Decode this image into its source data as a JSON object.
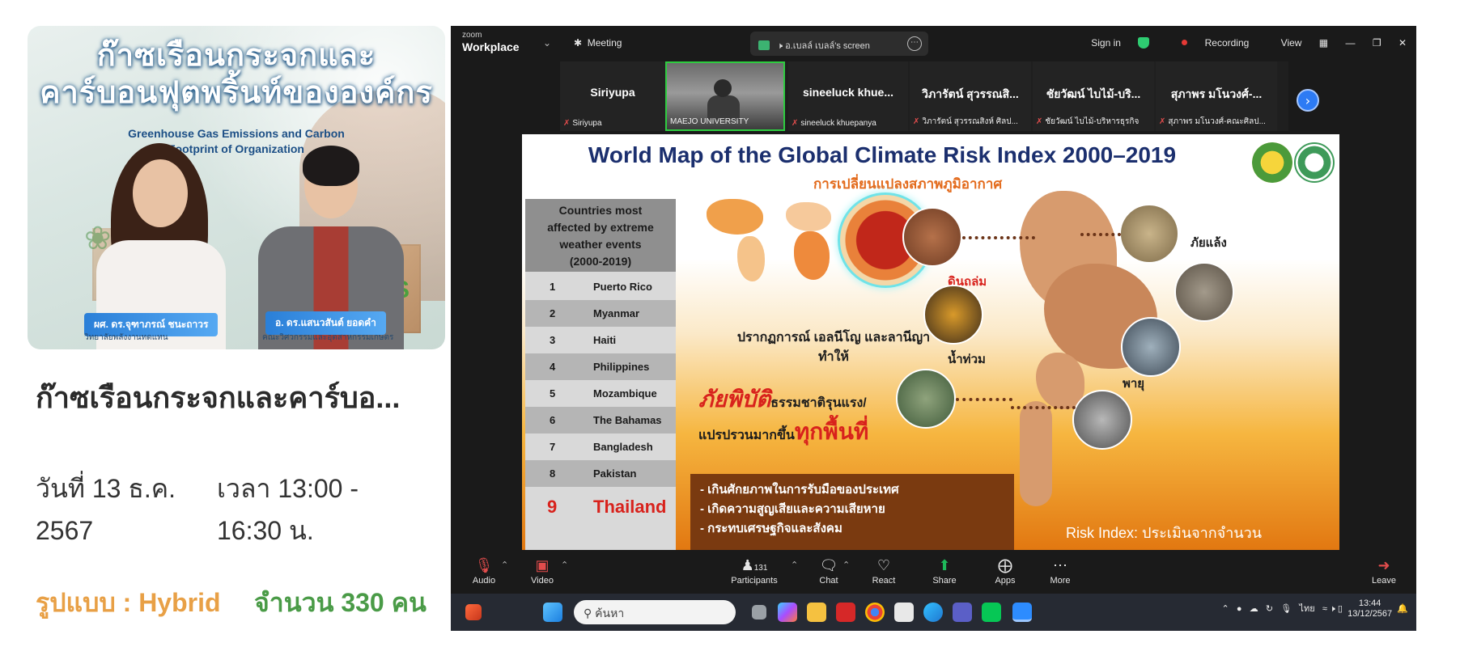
{
  "event": {
    "poster_title_line1": "ก๊าซเรือนกระจกและ",
    "poster_title_line2": "คาร์บอนฟุตพริ้นท์ขององค์กร",
    "poster_subtitle_line1": "Greenhouse Gas Emissions and Carbon",
    "poster_subtitle_line2": "Footprint of Organization",
    "speaker1_name": "ผศ. ดร.จุฑาภรณ์ ชนะถาวร",
    "speaker1_affiliation": "วิทยาลัยพลังงานทดแทน",
    "speaker2_name": "อ. ดร.แสนวสันต์ ยอดคำ",
    "speaker2_affiliation": "คณะวิศวกรรมและอุตสาหกรรมเกษตร",
    "poster_tag": "US",
    "title": "ก๊าซเรือนกระจกและคาร์บอ...",
    "date_line1": "วันที่ 13 ธ.ค.",
    "date_line2": "2567",
    "time_line1": "เวลา 13:00 -",
    "time_line2": "16:30 น.",
    "format": "รูปแบบ : Hybrid",
    "count": "จำนวน 330 คน"
  },
  "zoom": {
    "brand_top": "zoom",
    "brand_bottom": "Workplace",
    "meeting_label": "Meeting",
    "share_label": "อ.เบลล์ เบลล์'s screen",
    "sign_in": "Sign in",
    "recording": "Recording",
    "view": "View",
    "gallery": [
      {
        "name": "Siriyupa",
        "label": "Siriyupa"
      },
      {
        "name": "",
        "label": "MAEJO UNIVERSITY"
      },
      {
        "name": "sineeluck khue...",
        "label": "sineeluck khuepanya"
      },
      {
        "name": "วิภารัตน์ สุวรรณสิ...",
        "label": "วิภารัตน์ สุวรรณสิงห์ ศิลป..."
      },
      {
        "name": "ชัยวัฒน์ ไบไม้-บริ...",
        "label": "ชัยวัฒน์ ไบไม้-บริหารธุรกิจ"
      },
      {
        "name": "สุภาพร มโนวงศ์-...",
        "label": "สุภาพร มโนวงศ์-คณะศิลป..."
      }
    ],
    "controls": {
      "audio": "Audio",
      "video": "Video",
      "participants": "Participants",
      "participants_count": "131",
      "chat": "Chat",
      "react": "React",
      "share": "Share",
      "apps": "Apps",
      "more": "More",
      "leave": "Leave"
    }
  },
  "slide": {
    "title": "World Map of the Global Climate Risk Index 2000–2019",
    "subtitle": "การเปลี่ยนแปลงสภาพภูมิอากาศ",
    "rank_header_1": "Countries most",
    "rank_header_2": "affected by extreme",
    "rank_header_3": "weather events",
    "rank_header_4": "(2000-2019)",
    "ranks": [
      {
        "n": "1",
        "c": "Puerto Rico"
      },
      {
        "n": "2",
        "c": "Myanmar"
      },
      {
        "n": "3",
        "c": "Haiti"
      },
      {
        "n": "4",
        "c": "Philippines"
      },
      {
        "n": "5",
        "c": "Mozambique"
      },
      {
        "n": "6",
        "c": "The Bahamas"
      },
      {
        "n": "7",
        "c": "Bangladesh"
      },
      {
        "n": "8",
        "c": "Pakistan"
      },
      {
        "n": "9",
        "c": "Thailand"
      }
    ],
    "phenomenon_line1": "ปรากฏการณ์ เอลนีโญ และลานีญา",
    "phenomenon_line2": "ทำให้",
    "disaster_big": "ภัยพิบัติ",
    "disaster_rest": "ธรรมชาติรุนแรง/",
    "variance_text": "แปรปรวนมากขึ้น",
    "variance_big": "ทุกพื้นที่",
    "impacts": [
      "-  เกินศักยภาพในการรับมือของประเทศ",
      "-  เกิดความสูญเสียและความเสียหาย",
      "-  กระทบเศรษฐกิจและสังคม"
    ],
    "risk_index": "Risk Index: ประเมินจากจำนวน",
    "hazards": {
      "landslide": "ดินถล่ม",
      "drought": "ภัยแล้ง",
      "flood": "น้ำท่วม",
      "storm": "พายุ"
    }
  },
  "taskbar": {
    "search_placeholder": "ค้นหา",
    "lang": "ไทย",
    "time": "13:44",
    "date": "13/12/2567"
  },
  "colors": {
    "zoom_bg": "#1a1a1a",
    "accent_blue": "#2d7bf4",
    "record_red": "#e53935",
    "thailand_red": "#d8221c",
    "format_orange": "#e8a046",
    "count_green": "#4a9b47"
  }
}
